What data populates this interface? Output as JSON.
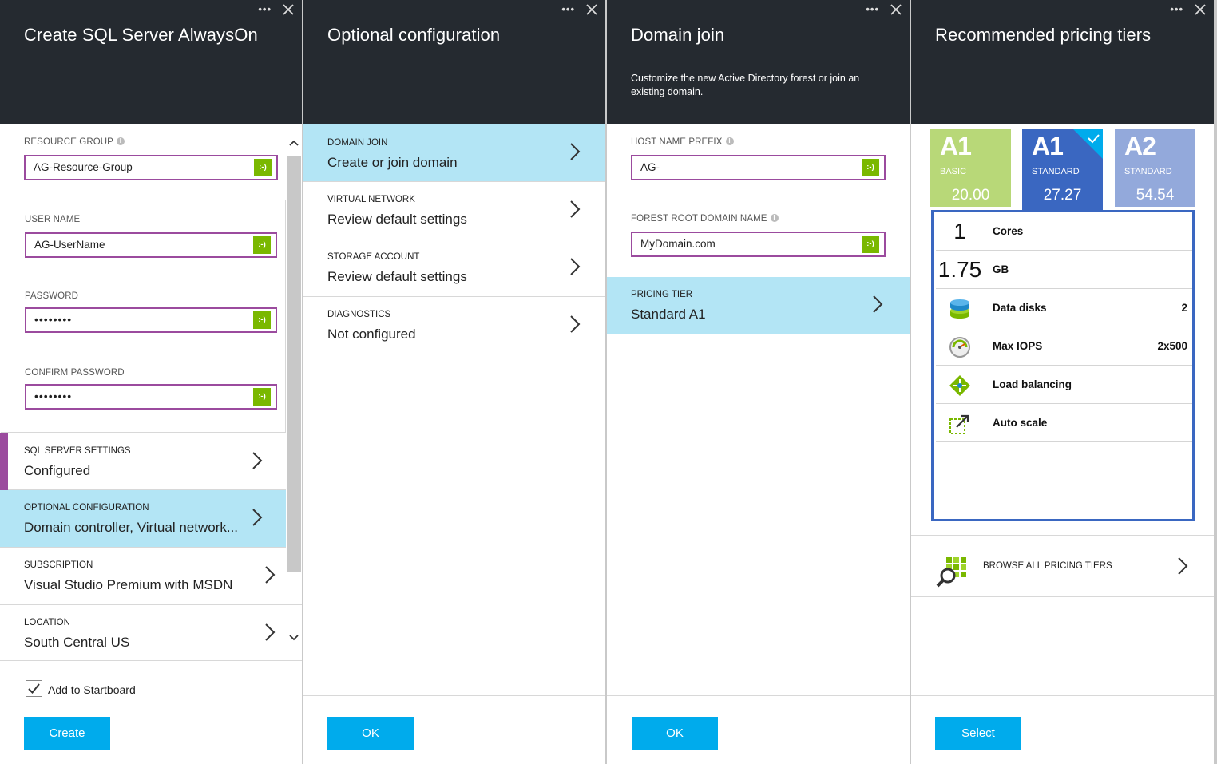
{
  "colors": {
    "header_bg": "#252a30",
    "accent_blue": "#00abec",
    "selected_row": "#b3e5f5",
    "field_border": "#9b4b9e",
    "valid_green": "#7ab800",
    "basic_tier": "#b8d878",
    "standard_tier_selected": "#3a67c1",
    "standard_tier": "#93a9db"
  },
  "blade1": {
    "title": "Create SQL Server AlwaysOn",
    "resource_group": {
      "label": "RESOURCE GROUP",
      "value": "AG-Resource-Group",
      "valid": ":-)"
    },
    "user_name": {
      "label": "USER NAME",
      "value": "AG-UserName",
      "valid": ":-)"
    },
    "password": {
      "label": "PASSWORD",
      "value": "••••••••",
      "valid": ":-)"
    },
    "confirm_password": {
      "label": "CONFIRM PASSWORD",
      "value": "••••••••",
      "valid": ":-)"
    },
    "nav": [
      {
        "label": "SQL SERVER SETTINGS",
        "value": "Configured"
      },
      {
        "label": "OPTIONAL CONFIGURATION",
        "value": "Domain controller, Virtual network..."
      },
      {
        "label": "SUBSCRIPTION",
        "value": "Visual Studio Premium with MSDN"
      },
      {
        "label": "LOCATION",
        "value": "South Central US"
      }
    ],
    "startboard_label": "Add to Startboard",
    "startboard_checked": true,
    "create_button": "Create"
  },
  "blade2": {
    "title": "Optional configuration",
    "nav": [
      {
        "label": "DOMAIN JOIN",
        "value": "Create or join domain"
      },
      {
        "label": "VIRTUAL NETWORK",
        "value": "Review default settings"
      },
      {
        "label": "STORAGE ACCOUNT",
        "value": "Review default settings"
      },
      {
        "label": "DIAGNOSTICS",
        "value": "Not configured"
      }
    ],
    "ok_button": "OK"
  },
  "blade3": {
    "title": "Domain join",
    "subtitle": "Customize the new Active Directory forest or join an existing domain.",
    "host_name_prefix": {
      "label": "HOST NAME PREFIX",
      "value": "AG-",
      "valid": ":-)"
    },
    "forest_root": {
      "label": "FOREST ROOT DOMAIN NAME",
      "value": "MyDomain.com",
      "valid": ":-)"
    },
    "pricing": {
      "label": "PRICING TIER",
      "value": "Standard A1"
    },
    "ok_button": "OK"
  },
  "blade4": {
    "title": "Recommended pricing tiers",
    "tiers": [
      {
        "name": "A1",
        "level": "BASIC",
        "price": "20.00"
      },
      {
        "name": "A1",
        "level": "STANDARD",
        "price": "27.27",
        "selected": true
      },
      {
        "name": "A2",
        "level": "STANDARD",
        "price": "54.54"
      }
    ],
    "specs": [
      {
        "big": "1",
        "label": "Cores"
      },
      {
        "big": "1.75",
        "label": "GB"
      },
      {
        "icon": "data-disks-icon",
        "label": "Data disks",
        "value": "2"
      },
      {
        "icon": "iops-gauge-icon",
        "label": "Max IOPS",
        "value": "2x500"
      },
      {
        "icon": "load-balancing-icon",
        "label": "Load balancing"
      },
      {
        "icon": "auto-scale-icon",
        "label": "Auto scale"
      }
    ],
    "browse_label": "BROWSE ALL PRICING TIERS",
    "select_button": "Select"
  }
}
